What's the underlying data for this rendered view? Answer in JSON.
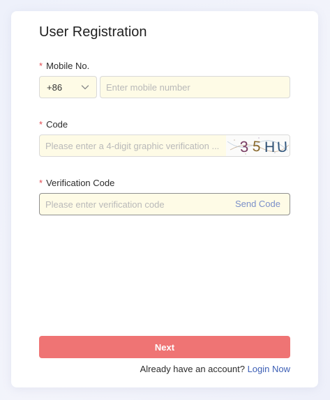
{
  "form": {
    "title": "User Registration",
    "required_mark": "*",
    "mobile": {
      "label": "Mobile No.",
      "country_code": "+86",
      "placeholder": "Enter mobile number",
      "value": ""
    },
    "captcha": {
      "label": "Code",
      "placeholder": "Please enter a 4-digit graphic verification ...",
      "value": "",
      "image_chars": [
        "3",
        "5",
        "H",
        "U"
      ]
    },
    "verification": {
      "label": "Verification Code",
      "placeholder": "Please enter verification code",
      "value": "",
      "send_label": "Send Code"
    },
    "next_label": "Next",
    "footer_text": "Already have an account?",
    "login_label": "Login Now"
  },
  "colors": {
    "required": "#e0494f",
    "input_bg": "#fefbe6",
    "primary_button": "#ef7474",
    "link": "#3d5fb5",
    "send_code": "#7b8fc9"
  },
  "icons": {
    "country_dropdown": "chevron-down-icon"
  }
}
